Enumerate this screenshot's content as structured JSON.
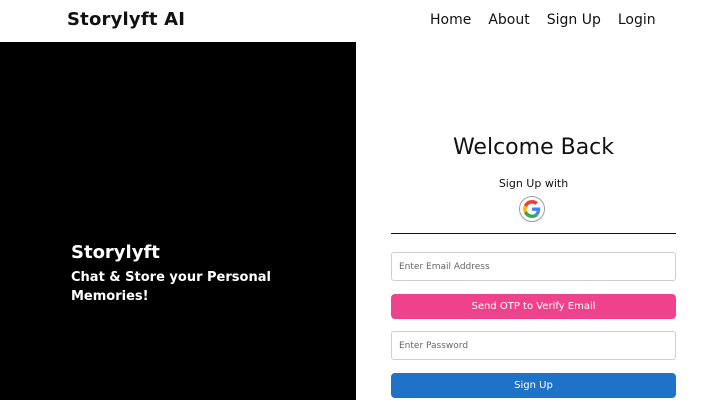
{
  "header": {
    "brand": "Storylyft AI",
    "nav": [
      "Home",
      "About",
      "Sign Up",
      "Login"
    ]
  },
  "hero": {
    "title": "Storylyft",
    "subtitle": "Chat & Store your Personal Memories!"
  },
  "form": {
    "title": "Welcome Back",
    "signup_with": "Sign Up with",
    "google_icon": "google-logo",
    "email_placeholder": "Enter Email Address",
    "email_value": "",
    "otp_button": "Send OTP to Verify Email",
    "password_placeholder": "Enter Password",
    "password_value": "",
    "signup_button": "Sign Up"
  },
  "colors": {
    "hero_bg": "#000000",
    "otp_button": "#f0418c",
    "signup_button": "#1e73c8"
  }
}
